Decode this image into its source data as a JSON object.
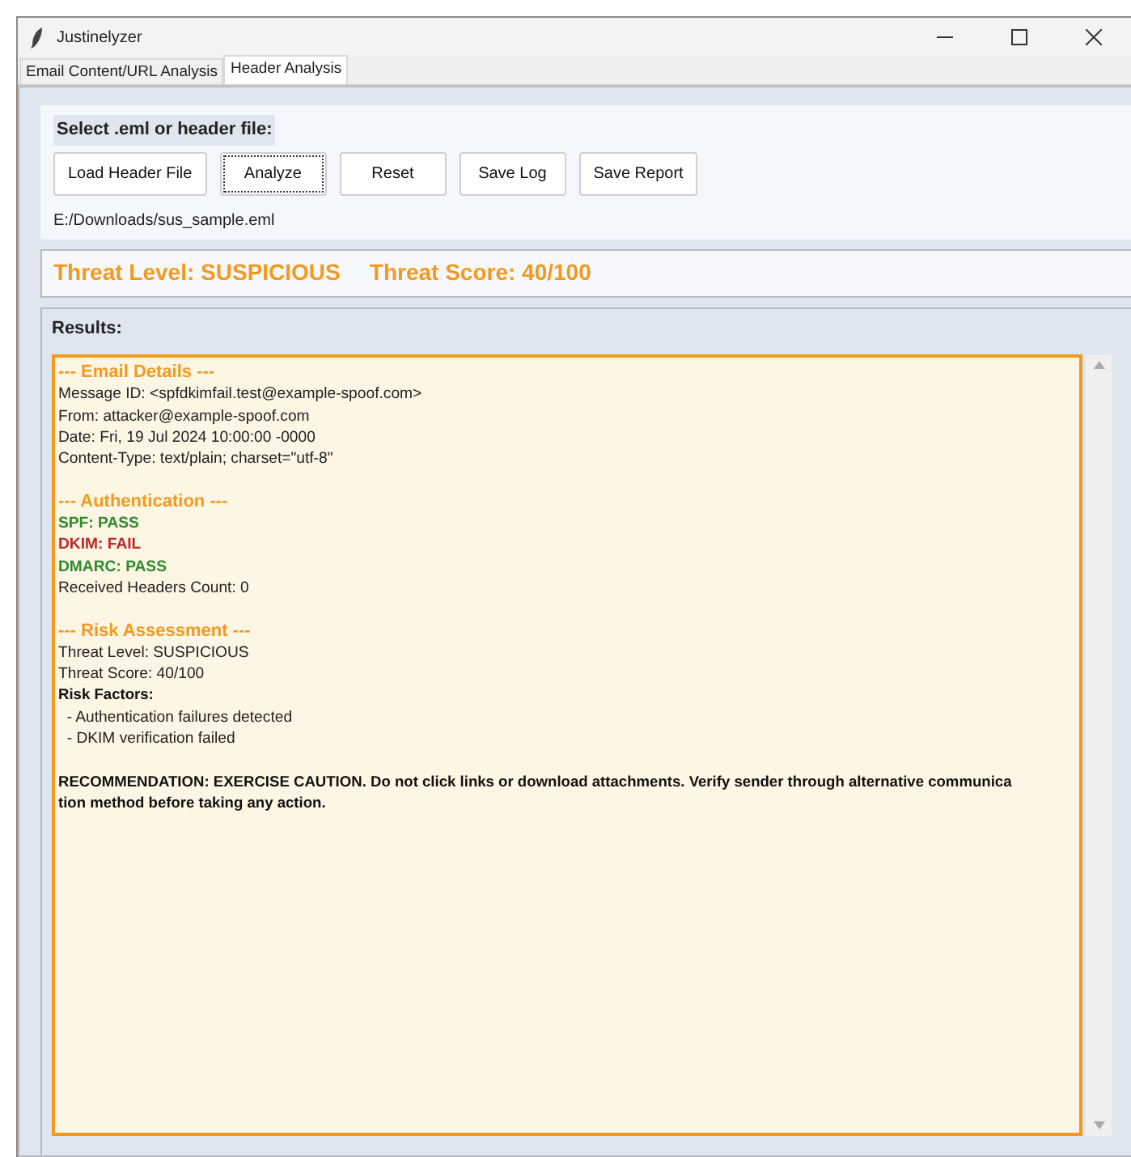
{
  "window": {
    "title": "Justinelyzer"
  },
  "tabs": [
    {
      "label": "Email Content/URL Analysis",
      "selected": false
    },
    {
      "label": "Header Analysis",
      "selected": true
    }
  ],
  "file_section": {
    "heading": "Select .eml or header file:",
    "buttons": [
      {
        "label": "Load Header File",
        "focused": false
      },
      {
        "label": "Analyze",
        "focused": true
      },
      {
        "label": "Reset",
        "focused": false
      },
      {
        "label": "Save Log",
        "focused": false
      },
      {
        "label": "Save Report",
        "focused": false
      }
    ],
    "file_path": "E:/Downloads/sus_sample.eml"
  },
  "threat": [
    "Threat Level: SUSPICIOUS",
    "Threat Score: 40/100"
  ],
  "results": {
    "heading": "Results:",
    "lines": [
      {
        "kind": "heading",
        "text": "--- Email Details ---"
      },
      {
        "kind": "text",
        "text": "Message ID: <spfdkimfail.test@example-spoof.com>"
      },
      {
        "kind": "text",
        "text": "From: attacker@example-spoof.com"
      },
      {
        "kind": "text",
        "text": "Date: Fri, 19 Jul 2024 10:00:00 -0000"
      },
      {
        "kind": "text",
        "text": "Content-Type: text/plain; charset=\"utf-8\""
      },
      {
        "kind": "blank"
      },
      {
        "kind": "heading",
        "text": "--- Authentication ---"
      },
      {
        "kind": "pass",
        "text": "SPF: PASS"
      },
      {
        "kind": "fail",
        "text": "DKIM: FAIL"
      },
      {
        "kind": "pass",
        "text": "DMARC: PASS"
      },
      {
        "kind": "text",
        "text": "Received Headers Count: 0"
      },
      {
        "kind": "blank"
      },
      {
        "kind": "heading",
        "text": "--- Risk Assessment ---"
      },
      {
        "kind": "text",
        "text": "Threat Level: SUSPICIOUS"
      },
      {
        "kind": "text",
        "text": "Threat Score: 40/100"
      },
      {
        "kind": "bold",
        "text": "Risk Factors:"
      },
      {
        "kind": "text",
        "text": "  - Authentication failures detected"
      },
      {
        "kind": "text",
        "text": "  - DKIM verification failed"
      },
      {
        "kind": "blank"
      },
      {
        "kind": "bold",
        "text": "RECOMMENDATION: EXERCISE CAUTION. Do not click links or download attachments. Verify sender through alternative communica"
      },
      {
        "kind": "bold",
        "text": "tion method before taking any action."
      }
    ]
  }
}
